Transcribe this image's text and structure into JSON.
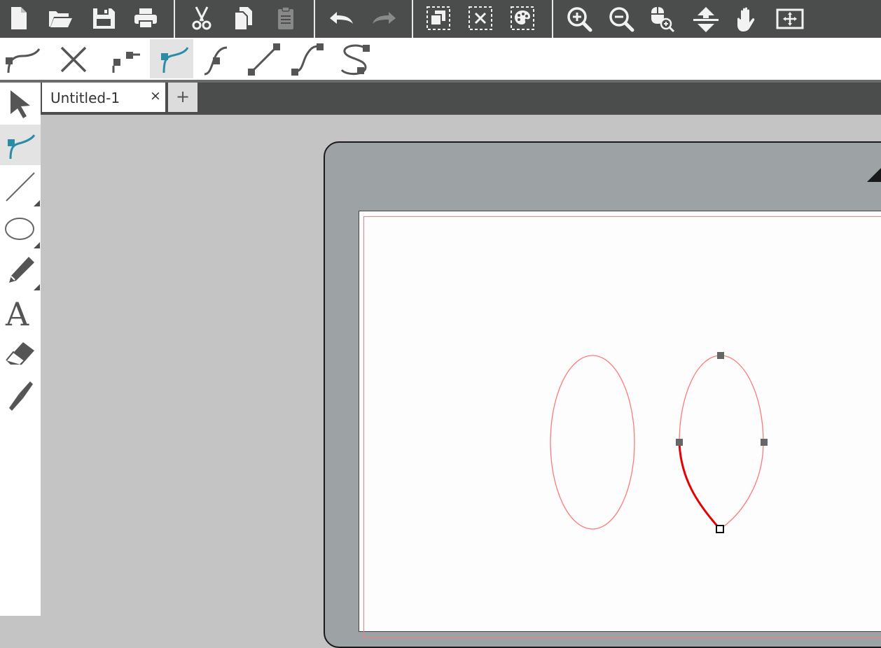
{
  "colors": {
    "toolbar_bg": "#4b4d4d",
    "icon_light": "#f2f2f2",
    "icon_dark": "#555555",
    "accent": "#2b8ca6",
    "cut_line": "#ff7a7a",
    "selected_segment": "#e60000",
    "mat": "#9da2a4"
  },
  "main_toolbar": {
    "items": [
      "new-document-icon",
      "open-folder-icon",
      "save-icon",
      "print-icon",
      "cut-icon",
      "copy-icon",
      "paste-icon",
      "undo-icon",
      "redo-icon",
      "group-icon",
      "ungroup-icon",
      "fill-style-icon",
      "zoom-in-icon",
      "zoom-out-icon",
      "zoom-selection-icon",
      "move-to-origin-icon",
      "pan-hand-icon",
      "fit-to-page-icon"
    ]
  },
  "node_toolbar": {
    "items": [
      "edit-curve-icon",
      "delete-node-icon",
      "break-node-icon",
      "corner-node-icon",
      "smooth-node-icon",
      "line-segment-icon",
      "curve-segment-icon",
      "bezier-curve-icon"
    ],
    "active": "corner-node-icon"
  },
  "tools": {
    "items": [
      "select-tool-icon",
      "edit-points-tool-icon",
      "line-tool-icon",
      "ellipse-tool-icon",
      "pencil-tool-icon",
      "text-tool-icon",
      "eraser-tool-icon",
      "knife-tool-icon"
    ],
    "active": "edit-points-tool-icon",
    "text_tool_glyph": "A"
  },
  "tabs": {
    "documents": [
      {
        "label": "Untitled-1",
        "close": "×"
      }
    ],
    "new_tab_label": "+"
  }
}
